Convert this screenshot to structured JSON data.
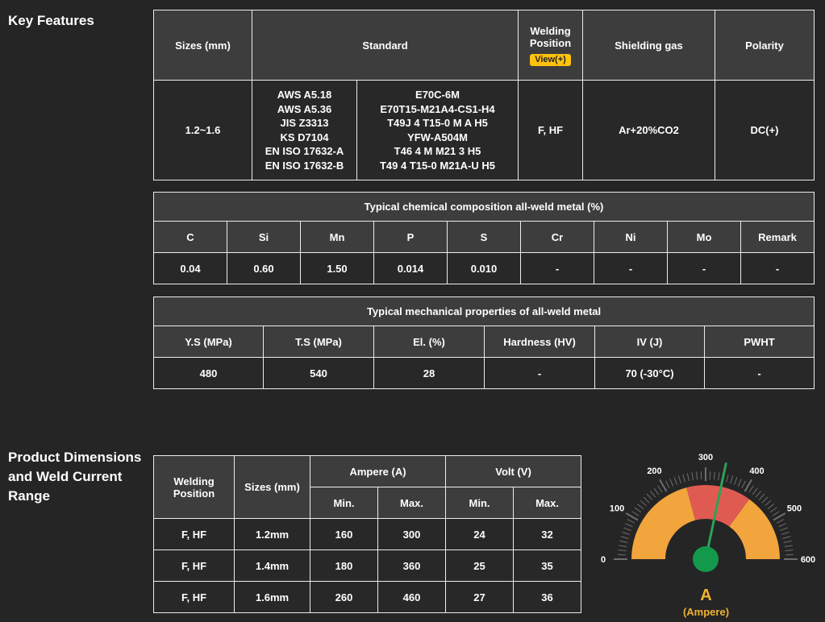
{
  "page": {
    "heading_key_features": "Key Features",
    "heading_product_dimensions": "Product Dimensions and Weld Current Range"
  },
  "spec_table": {
    "headers": {
      "sizes": "Sizes (mm)",
      "standard": "Standard",
      "welding_position": "Welding Position",
      "view_button": "View(+)",
      "shielding_gas": "Shielding gas",
      "polarity": "Polarity"
    },
    "row": {
      "sizes": "1.2~1.6",
      "standard_col1": [
        "AWS A5.18",
        "AWS A5.36",
        "JIS Z3313",
        "KS D7104",
        "EN ISO 17632-A",
        "EN ISO 17632-B"
      ],
      "standard_col2": [
        "E70C-6M",
        "E70T15-M21A4-CS1-H4",
        "T49J 4 T15-0 M A H5",
        "YFW-A504M",
        "T46 4 M M21 3 H5",
        "T49 4 T15-0 M21A-U H5"
      ],
      "welding_position": "F, HF",
      "shielding_gas": "Ar+20%CO2",
      "polarity": "DC(+)"
    }
  },
  "chemical_table": {
    "title": "Typical chemical composition all-weld metal (%)",
    "columns": [
      "C",
      "Si",
      "Mn",
      "P",
      "S",
      "Cr",
      "Ni",
      "Mo",
      "Remark"
    ],
    "values": [
      "0.04",
      "0.60",
      "1.50",
      "0.014",
      "0.010",
      "-",
      "-",
      "-",
      "-"
    ]
  },
  "mechanical_table": {
    "title": "Typical mechanical properties of all-weld metal",
    "columns": [
      "Y.S (MPa)",
      "T.S (MPa)",
      "El. (%)",
      "Hardness (HV)",
      "IV (J)",
      "PWHT"
    ],
    "values": [
      "480",
      "540",
      "28",
      "-",
      "70 (-30°C)",
      "-"
    ]
  },
  "current_table": {
    "headers": {
      "welding_position": "Welding Position",
      "sizes": "Sizes (mm)",
      "ampere": "Ampere (A)",
      "volt": "Volt (V)",
      "min": "Min.",
      "max": "Max."
    },
    "rows": [
      {
        "position": "F, HF",
        "size": "1.2mm",
        "amp_min": "160",
        "amp_max": "300",
        "volt_min": "24",
        "volt_max": "32"
      },
      {
        "position": "F, HF",
        "size": "1.4mm",
        "amp_min": "180",
        "amp_max": "360",
        "volt_min": "25",
        "volt_max": "35"
      },
      {
        "position": "F, HF",
        "size": "1.6mm",
        "amp_min": "260",
        "amp_max": "460",
        "volt_min": "27",
        "volt_max": "36"
      }
    ]
  },
  "chart_data": {
    "type": "gauge",
    "title": "A (Ampere)",
    "min": 0,
    "max": 600,
    "minor_step": 10,
    "major_step": 100,
    "tick_labels": [
      0,
      100,
      200,
      300,
      400,
      500,
      600
    ],
    "zones": [
      {
        "from": 0,
        "to": 250,
        "color": "#f2a53c"
      },
      {
        "from": 250,
        "to": 420,
        "color": "#df5b52"
      },
      {
        "from": 420,
        "to": 600,
        "color": "#f2a53c"
      }
    ],
    "needle_value": 340,
    "needle_color": "#2da259",
    "hub_color": "#13994b",
    "tick_color": "#6e6e6e",
    "label_color": "#ffffff",
    "unit": "A",
    "unit_caption": "(Ampere)"
  },
  "colors": {
    "badge_bg": "#ffc20e",
    "amp_value": "#e3a940",
    "gauge_label": "#f0b32e"
  }
}
